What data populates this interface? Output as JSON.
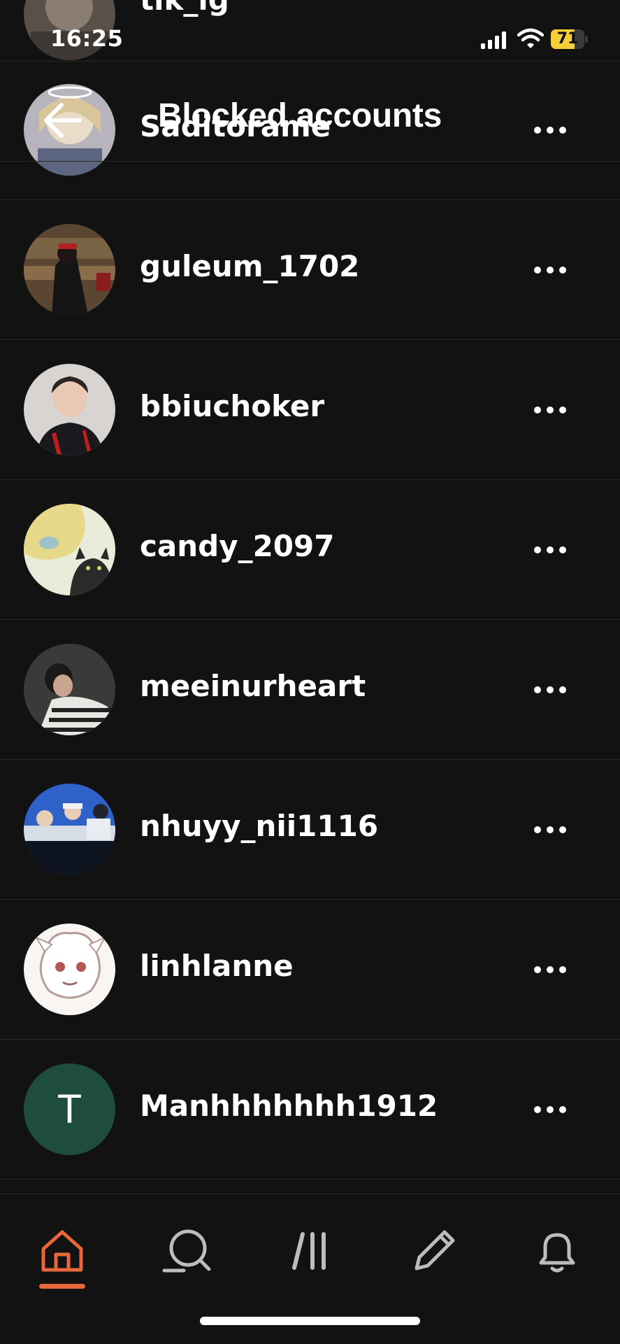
{
  "status_bar": {
    "time": "16:25",
    "battery_level": "71",
    "battery_fraction": 0.71
  },
  "header": {
    "title": "Blocked accounts"
  },
  "partial_row": {
    "username": "tik_lg"
  },
  "blocked_accounts": [
    {
      "username": "Saditorame",
      "avatar": "photo-avatar"
    },
    {
      "username": "guleum_1702",
      "avatar": "photo-avatar"
    },
    {
      "username": "bbiuchoker",
      "avatar": "photo-avatar"
    },
    {
      "username": "candy_2097",
      "avatar": "photo-avatar"
    },
    {
      "username": "meeinurheart",
      "avatar": "photo-avatar"
    },
    {
      "username": "nhuyy_nii1116",
      "avatar": "photo-avatar"
    },
    {
      "username": "linhlanne",
      "avatar": "photo-avatar"
    },
    {
      "username": "Manhhhhhhh1912",
      "avatar": "letter-avatar",
      "avatar_letter": "T",
      "avatar_color": "#1f4d3d"
    }
  ],
  "tab_bar": {
    "tabs": [
      {
        "name": "home-icon",
        "active": true
      },
      {
        "name": "search-icon",
        "active": false
      },
      {
        "name": "feed-icon",
        "active": false
      },
      {
        "name": "pencil-icon",
        "active": false
      },
      {
        "name": "bell-icon",
        "active": false
      }
    ],
    "accent_color": "#e8663b"
  }
}
